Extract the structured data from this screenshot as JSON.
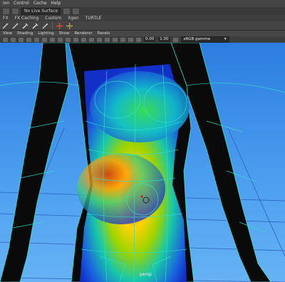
{
  "menubar": {
    "items": [
      "ion",
      "Control",
      "Cache",
      "Help"
    ]
  },
  "statusline": {
    "live_surface": "No Live Surface"
  },
  "shelf_tabs": [
    "FX",
    "FX Caching",
    "Custom",
    "Xgen",
    "TURTLE"
  ],
  "panel_menu": [
    "View",
    "Shading",
    "Lighting",
    "Show",
    "Renderer",
    "Panels"
  ],
  "panel_toolbar": {
    "near_value": "0.00",
    "far_value": "1.00",
    "color_space": "sRGB gamma"
  },
  "viewport": {
    "camera_label": "persp",
    "colors": {
      "sky_top": "#2c7de0",
      "sky_bottom": "#67b2f4",
      "wireframe": "#35e0c9",
      "grid": "#1f4fb0"
    }
  }
}
